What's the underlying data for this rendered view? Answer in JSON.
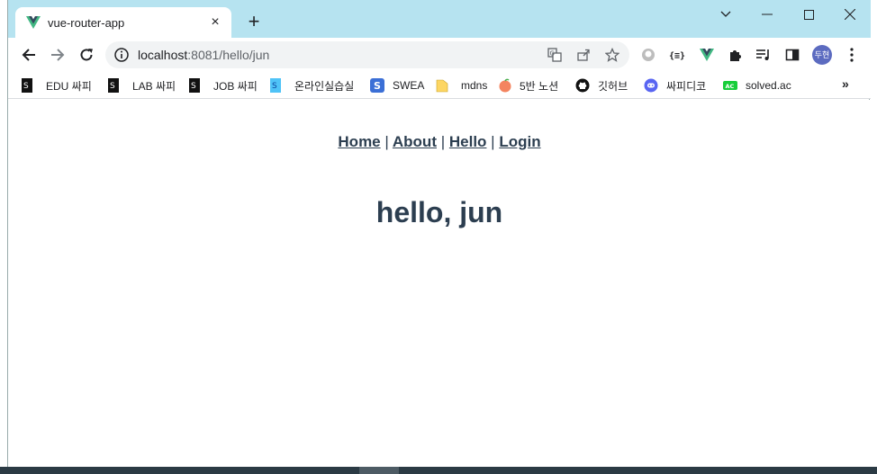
{
  "tab": {
    "title": "vue-router-app",
    "close": "×"
  },
  "newtab": "+",
  "address": {
    "host": "localhost",
    "path": ":8081/hello/jun"
  },
  "bookmarks": [
    {
      "label": "EDU 싸피",
      "icon": "ssafy-icon"
    },
    {
      "label": "LAB 싸피",
      "icon": "ssafy-icon"
    },
    {
      "label": "JOB 싸피",
      "icon": "ssafy-icon"
    },
    {
      "label": "온라인실습실",
      "icon": "ssafy-blue-icon"
    },
    {
      "label": "SWEA",
      "icon": "swea-icon"
    },
    {
      "label": "mdns",
      "icon": "folder-icon"
    },
    {
      "label": "5반 노션",
      "icon": "peach-icon"
    },
    {
      "label": "깃허브",
      "icon": "github-icon"
    },
    {
      "label": "싸피디코",
      "icon": "discord-icon"
    },
    {
      "label": "solved.ac",
      "icon": "solvedac-icon"
    }
  ],
  "bookmarks_more": "»",
  "profile": {
    "initials": "두현"
  },
  "page": {
    "nav": [
      {
        "label": "Home"
      },
      {
        "label": "About"
      },
      {
        "label": "Hello"
      },
      {
        "label": "Login"
      }
    ],
    "nav_separator": "|",
    "heading": "hello, jun"
  },
  "colors": {
    "tabstrip": "#b6e3f0",
    "text": "#2c3e50",
    "vue_green": "#42b883",
    "vue_dark": "#35495e"
  }
}
